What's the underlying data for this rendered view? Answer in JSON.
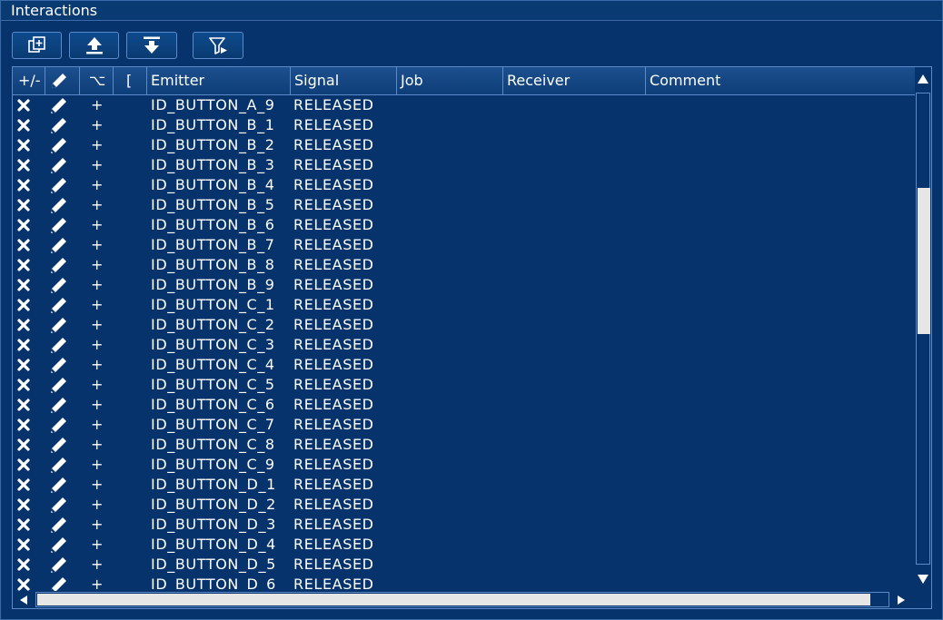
{
  "window": {
    "title": "Interactions"
  },
  "toolbar": {
    "buttons": [
      {
        "name": "add-interaction-button",
        "icon": "copy-plus-icon"
      },
      {
        "name": "move-up-button",
        "icon": "upload-arrow-icon"
      },
      {
        "name": "move-down-button",
        "icon": "download-arrow-icon"
      },
      {
        "name": "filter-button",
        "icon": "filter-icon"
      }
    ]
  },
  "table": {
    "columns": [
      {
        "key": "plusminus",
        "label": "+/-"
      },
      {
        "key": "edit",
        "label": "",
        "icon": "pencil-icon"
      },
      {
        "key": "option",
        "label": "⌥"
      },
      {
        "key": "bracket",
        "label": "["
      },
      {
        "key": "emitter",
        "label": "Emitter"
      },
      {
        "key": "signal",
        "label": "Signal"
      },
      {
        "key": "job",
        "label": "Job"
      },
      {
        "key": "receiver",
        "label": "Receiver"
      },
      {
        "key": "comment",
        "label": "Comment"
      }
    ],
    "rows": [
      {
        "option": "+",
        "emitter": "ID_BUTTON_A_9",
        "signal": "RELEASED"
      },
      {
        "option": "+",
        "emitter": "ID_BUTTON_B_1",
        "signal": "RELEASED"
      },
      {
        "option": "+",
        "emitter": "ID_BUTTON_B_2",
        "signal": "RELEASED"
      },
      {
        "option": "+",
        "emitter": "ID_BUTTON_B_3",
        "signal": "RELEASED"
      },
      {
        "option": "+",
        "emitter": "ID_BUTTON_B_4",
        "signal": "RELEASED"
      },
      {
        "option": "+",
        "emitter": "ID_BUTTON_B_5",
        "signal": "RELEASED"
      },
      {
        "option": "+",
        "emitter": "ID_BUTTON_B_6",
        "signal": "RELEASED"
      },
      {
        "option": "+",
        "emitter": "ID_BUTTON_B_7",
        "signal": "RELEASED"
      },
      {
        "option": "+",
        "emitter": "ID_BUTTON_B_8",
        "signal": "RELEASED"
      },
      {
        "option": "+",
        "emitter": "ID_BUTTON_B_9",
        "signal": "RELEASED"
      },
      {
        "option": "+",
        "emitter": "ID_BUTTON_C_1",
        "signal": "RELEASED"
      },
      {
        "option": "+",
        "emitter": "ID_BUTTON_C_2",
        "signal": "RELEASED"
      },
      {
        "option": "+",
        "emitter": "ID_BUTTON_C_3",
        "signal": "RELEASED"
      },
      {
        "option": "+",
        "emitter": "ID_BUTTON_C_4",
        "signal": "RELEASED"
      },
      {
        "option": "+",
        "emitter": "ID_BUTTON_C_5",
        "signal": "RELEASED"
      },
      {
        "option": "+",
        "emitter": "ID_BUTTON_C_6",
        "signal": "RELEASED"
      },
      {
        "option": "+",
        "emitter": "ID_BUTTON_C_7",
        "signal": "RELEASED"
      },
      {
        "option": "+",
        "emitter": "ID_BUTTON_C_8",
        "signal": "RELEASED"
      },
      {
        "option": "+",
        "emitter": "ID_BUTTON_C_9",
        "signal": "RELEASED"
      },
      {
        "option": "+",
        "emitter": "ID_BUTTON_D_1",
        "signal": "RELEASED"
      },
      {
        "option": "+",
        "emitter": "ID_BUTTON_D_2",
        "signal": "RELEASED"
      },
      {
        "option": "+",
        "emitter": "ID_BUTTON_D_3",
        "signal": "RELEASED"
      },
      {
        "option": "+",
        "emitter": "ID_BUTTON_D_4",
        "signal": "RELEASED"
      },
      {
        "option": "+",
        "emitter": "ID_BUTTON_D_5",
        "signal": "RELEASED"
      },
      {
        "option": "+",
        "emitter": "ID_BUTTON_D_6",
        "signal": "RELEASED"
      }
    ]
  },
  "scroll": {
    "vertical_position": 0.2,
    "vertical_visible_fraction": 0.31,
    "horizontal_position": 0.0,
    "horizontal_visible_fraction": 0.98
  },
  "colors": {
    "background": "#06336b",
    "border": "#5a8ac8",
    "text": "#ffffff",
    "scroll_thumb": "#e6e6e6"
  }
}
